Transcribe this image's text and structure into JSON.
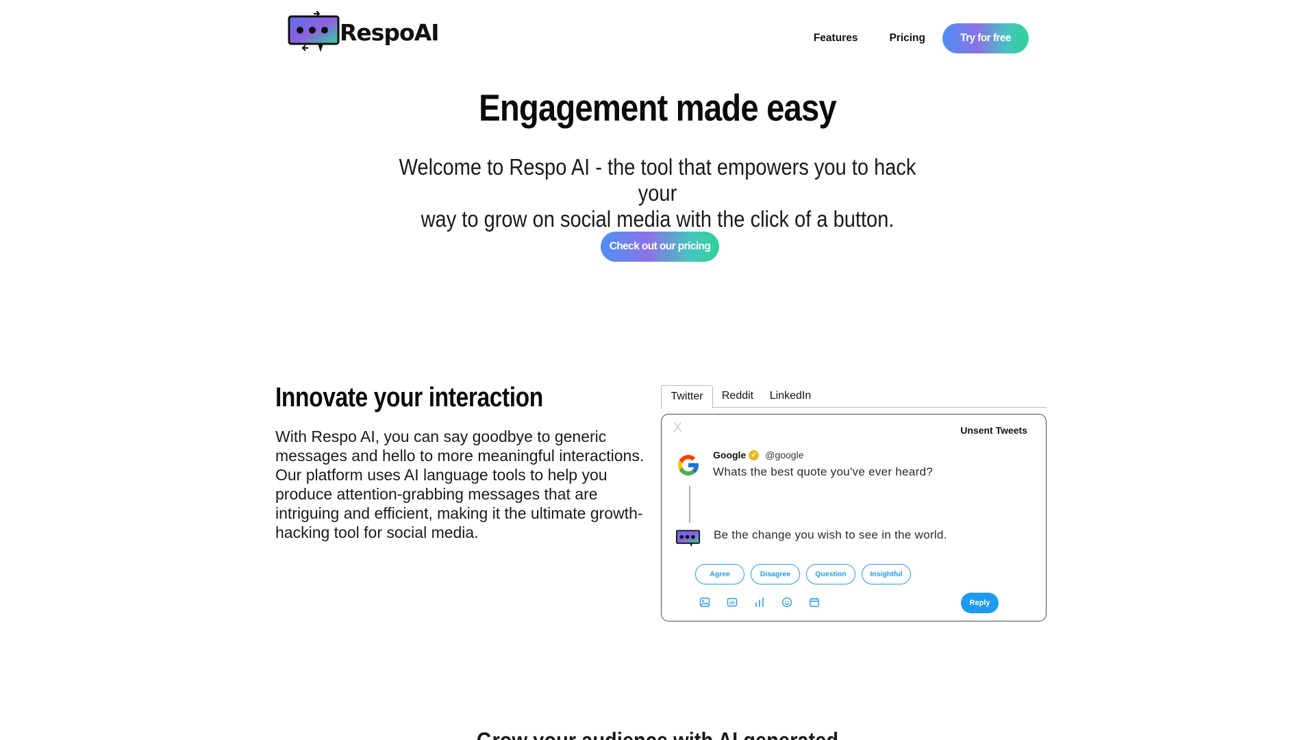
{
  "brand": {
    "name": "RespoAI"
  },
  "nav": {
    "links": [
      "Features",
      "Pricing"
    ],
    "cta": "Try for free"
  },
  "hero": {
    "title": "Engagement made easy",
    "subtitle_line1": "Welcome to Respo AI - the tool that empowers you to hack your",
    "subtitle_line2": "way to grow on social media with the click of a button.",
    "cta": "Check out our pricing"
  },
  "feature": {
    "title": "Innovate your interaction",
    "text": "With Respo AI, you can say goodbye to generic messages and hello to more meaningful interactions. Our platform uses AI language tools to help you produce attention-grabbing messages that are intriguing and efficient, making it the ultimate growth-hacking tool for social media."
  },
  "tabs": [
    "Twitter",
    "Reddit",
    "LinkedIn"
  ],
  "active_tab": "Twitter",
  "card": {
    "close": "X",
    "label": "Unsent Tweets",
    "tweet": {
      "author": "Google",
      "handle": "@google",
      "text": "Whats the best quote you've ever heard?"
    },
    "reply_text": "Be the change you wish to see in the world.",
    "chips": [
      "Agree",
      "Disagree",
      "Question",
      "Insightful"
    ],
    "tool_icons": [
      "image-icon",
      "gif-icon",
      "poll-icon",
      "emoji-icon",
      "schedule-icon"
    ],
    "reply_button": "Reply"
  },
  "next_section": {
    "heading": "Grow your audience with AI generated"
  },
  "colors": {
    "accent_blue": "#1d9bf0",
    "gradient": [
      "#4e8ff5",
      "#8a72e6",
      "#46c3c0",
      "#2ed49a"
    ],
    "verified": "#e8b81c"
  }
}
